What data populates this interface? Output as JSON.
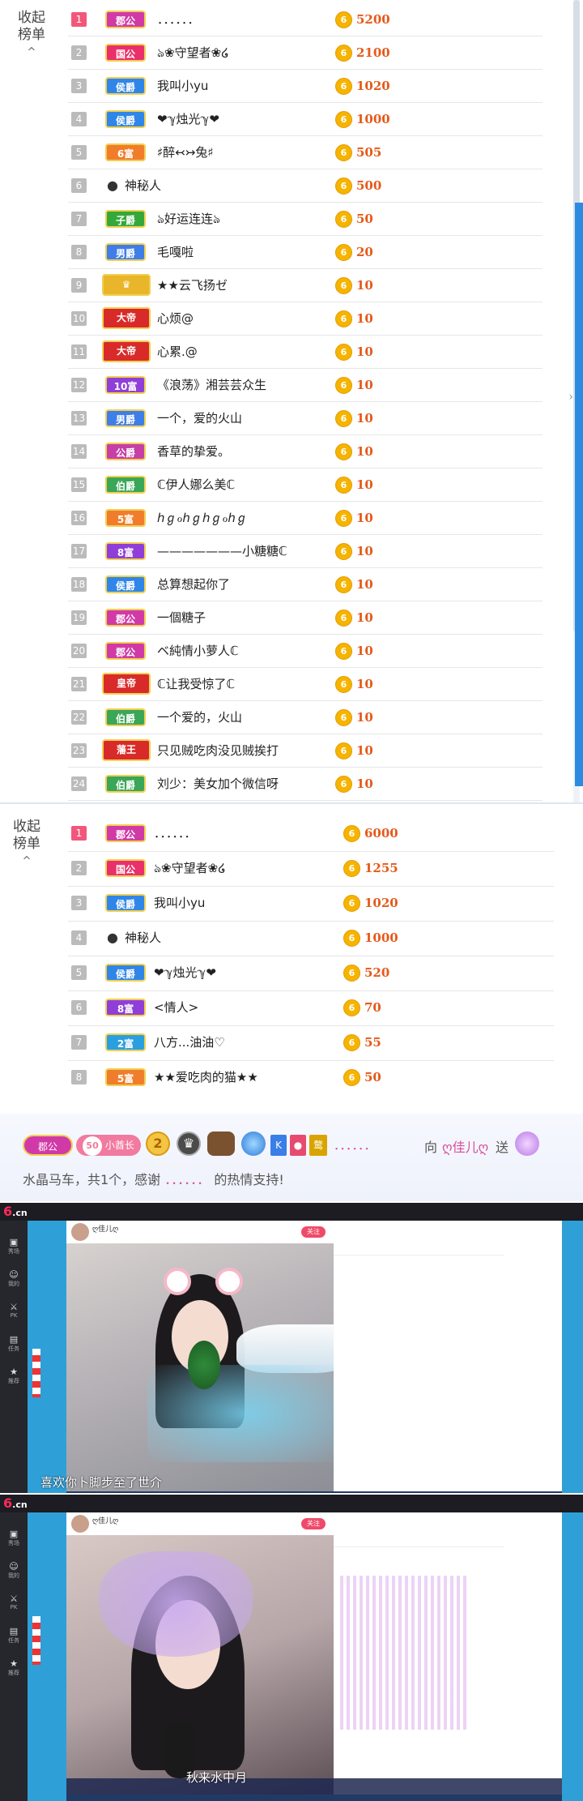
{
  "panel1": {
    "collapse_label_1": "收起",
    "collapse_label_2": "榜单",
    "collapse_arrow": "^",
    "rows": [
      {
        "rank": "1",
        "badge": "郡公",
        "badge_color": "#d13aa6",
        "name": "．．．．．．",
        "amount": "5200"
      },
      {
        "rank": "2",
        "badge": "国公",
        "badge_color": "#e9306b",
        "name": "ঌ❀守望者❀໒",
        "amount": "2100"
      },
      {
        "rank": "3",
        "badge": "侯爵",
        "badge_color": "#2f86e8",
        "name": "我叫小yu",
        "amount": "1020"
      },
      {
        "rank": "4",
        "badge": "侯爵",
        "badge_color": "#2f86e8",
        "name": "❤ℽ烛光ℽ❤",
        "amount": "1000"
      },
      {
        "rank": "5",
        "badge": "6富",
        "badge_color": "#f07d2b",
        "name": "♯醉↢↣兔♯",
        "amount": "505"
      },
      {
        "rank": "6",
        "badge": "",
        "badge_color": "",
        "name": "神秘人",
        "amount": "500"
      },
      {
        "rank": "7",
        "badge": "子爵",
        "badge_color": "#35a83a",
        "name": "ঌ好运连连ঌ",
        "amount": "50"
      },
      {
        "rank": "8",
        "badge": "男爵",
        "badge_color": "#3f7de8",
        "name": "毛嘎啦",
        "amount": "20"
      },
      {
        "rank": "9",
        "badge": "",
        "badge_color": "#e9b52a",
        "name": "★★云飞扬ゼ",
        "amount": "10"
      },
      {
        "rank": "10",
        "badge": "大帝",
        "badge_color": "#d92a2a",
        "name": "心烦@",
        "amount": "10"
      },
      {
        "rank": "11",
        "badge": "大帝",
        "badge_color": "#d92a2a",
        "name": "心累.@",
        "amount": "10"
      },
      {
        "rank": "12",
        "badge": "10富",
        "badge_color": "#8f3fd8",
        "name": "《浪荡》湘芸芸众生",
        "amount": "10"
      },
      {
        "rank": "13",
        "badge": "男爵",
        "badge_color": "#3f7de8",
        "name": "一个，爱的火山",
        "amount": "10"
      },
      {
        "rank": "14",
        "badge": "公爵",
        "badge_color": "#c53fa7",
        "name": "香草的挚爱。",
        "amount": "10"
      },
      {
        "rank": "15",
        "badge": "伯爵",
        "badge_color": "#3aa657",
        "name": "ℂ伊人娜么美ℂ",
        "amount": "10"
      },
      {
        "rank": "16",
        "badge": "5富",
        "badge_color": "#f07d2b",
        "name": "ℎℊℴℎℊℎℊℴℎℊ",
        "amount": "10"
      },
      {
        "rank": "17",
        "badge": "8富",
        "badge_color": "#8f3fd8",
        "name": "———————小糖糖ℂ",
        "amount": "10"
      },
      {
        "rank": "18",
        "badge": "侯爵",
        "badge_color": "#2f86e8",
        "name": "总算想起你了",
        "amount": "10"
      },
      {
        "rank": "19",
        "badge": "郡公",
        "badge_color": "#d13aa6",
        "name": "一個糖子",
        "amount": "10"
      },
      {
        "rank": "20",
        "badge": "郡公",
        "badge_color": "#d13aa6",
        "name": "ベ純情小萝人ℂ",
        "amount": "10"
      },
      {
        "rank": "21",
        "badge": "皇帝",
        "badge_color": "#d92a2a",
        "name": "ℂ让我受惊了ℂ",
        "amount": "10"
      },
      {
        "rank": "22",
        "badge": "伯爵",
        "badge_color": "#3aa657",
        "name": "一个爱的，火山",
        "amount": "10"
      },
      {
        "rank": "23",
        "badge": "藩王",
        "badge_color": "#d92a2a",
        "name": "只见贼吃肉没见贼挨打",
        "amount": "10"
      },
      {
        "rank": "24",
        "badge": "伯爵",
        "badge_color": "#3aa657",
        "name": "刘少：美女加个微信呀",
        "amount": "10"
      }
    ]
  },
  "panel2": {
    "collapse_label_1": "收起",
    "collapse_label_2": "榜单",
    "collapse_arrow": "^",
    "rows": [
      {
        "rank": "1",
        "badge": "郡公",
        "badge_color": "#d13aa6",
        "name": "．．．．．．",
        "amount": "6000"
      },
      {
        "rank": "2",
        "badge": "国公",
        "badge_color": "#e9306b",
        "name": "ঌ❀守望者❀໒",
        "amount": "1255"
      },
      {
        "rank": "3",
        "badge": "侯爵",
        "badge_color": "#2f86e8",
        "name": "我叫小yu",
        "amount": "1020"
      },
      {
        "rank": "4",
        "badge": "",
        "badge_color": "",
        "name": "神秘人",
        "amount": "1000"
      },
      {
        "rank": "5",
        "badge": "侯爵",
        "badge_color": "#2f86e8",
        "name": "❤ℽ烛光ℽ❤",
        "amount": "520"
      },
      {
        "rank": "6",
        "badge": "8富",
        "badge_color": "#8f3fd8",
        "name": "<情人>",
        "amount": "70"
      },
      {
        "rank": "7",
        "badge": "2富",
        "badge_color": "#2a9fe0",
        "name": "八方...油油♡",
        "amount": "55"
      },
      {
        "rank": "8",
        "badge": "5富",
        "badge_color": "#f07d2b",
        "name": "★★爱吃肉的猫★★",
        "amount": "50"
      }
    ]
  },
  "coin_glyph": "6",
  "gift_banner": {
    "badge": "郡公",
    "level": "50",
    "level_tag": "小酋长",
    "k_tag": "K",
    "yellow_tag": "鹜",
    "sender": "．．．．．．",
    "to_word": "向",
    "receiver": "ღ佳儿ღ",
    "send_word": "送",
    "line2_prefix": "水晶马车，共1个，感谢",
    "line2_name": "．．．．．．",
    "line2_suffix": "的热情支持!"
  },
  "screens": [
    {
      "logo_main": "6",
      "logo_suffix": ".cn",
      "host_name": "ღ佳儿ღ",
      "follow_label": "关注",
      "caption": "喜欢你卜脚步至了世介",
      "left_items": [
        "秀场",
        "我的",
        "PK",
        "任务",
        "推荐"
      ]
    },
    {
      "logo_main": "6",
      "logo_suffix": ".cn",
      "host_name": "ღ佳儿ღ",
      "follow_label": "关注",
      "caption": "秋来水中月",
      "left_items": [
        "秀场",
        "我的",
        "PK",
        "任务",
        "推荐"
      ]
    }
  ],
  "colors": {
    "accent_rank1": "#f2577b",
    "amount": "#e6591a",
    "coin": "#f5b400"
  }
}
